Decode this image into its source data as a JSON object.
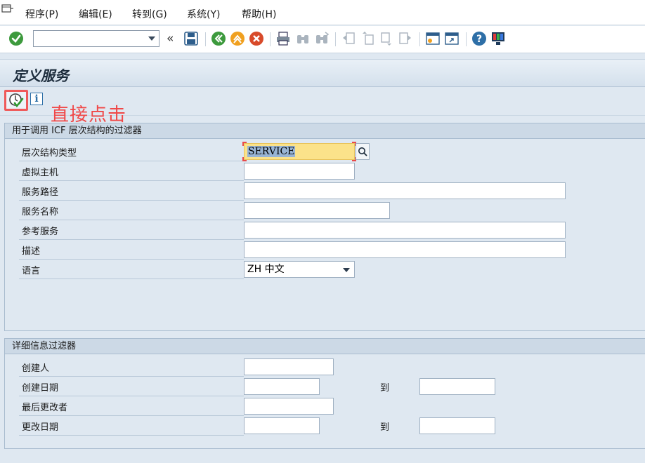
{
  "menu": {
    "items": [
      {
        "label": "程序(P)"
      },
      {
        "label": "编辑(E)"
      },
      {
        "label": "转到(G)"
      },
      {
        "label": "系统(Y)"
      },
      {
        "label": "帮助(H)"
      }
    ]
  },
  "toolbar": {
    "command_value": "",
    "icons": [
      "enter-icon",
      "back-icon",
      "exit-icon",
      "cancel-icon",
      "save-icon",
      "print-icon",
      "find-icon",
      "find-next-icon",
      "first-page-icon",
      "prev-page-icon",
      "next-page-icon",
      "last-page-icon",
      "new-session-icon",
      "shortcut-icon",
      "help-icon",
      "customize-layout-icon"
    ]
  },
  "title": "定义服务",
  "annotation": "直接点击",
  "filter_group": {
    "title": "用于调用 ICF 层次结构的过滤器",
    "fields": [
      {
        "label": "层次结构类型",
        "value": "SERVICE"
      },
      {
        "label": "虚拟主机",
        "value": ""
      },
      {
        "label": "服务路径",
        "value": ""
      },
      {
        "label": "服务名称",
        "value": ""
      },
      {
        "label": "参考服务",
        "value": ""
      },
      {
        "label": "描述",
        "value": ""
      },
      {
        "label": "语言",
        "value": "ZH 中文"
      }
    ]
  },
  "detail_group": {
    "title": "详细信息过滤器",
    "fields": [
      {
        "label": "创建人",
        "value": ""
      },
      {
        "label": "创建日期",
        "value": "",
        "to_label": "到",
        "to_value": ""
      },
      {
        "label": "最后更改者",
        "value": ""
      },
      {
        "label": "更改日期",
        "value": "",
        "to_label": "到",
        "to_value": ""
      }
    ]
  },
  "colors": {
    "background": "#dfe8f1",
    "annotation": "#f04848",
    "focus_field": "#fbe28a"
  }
}
